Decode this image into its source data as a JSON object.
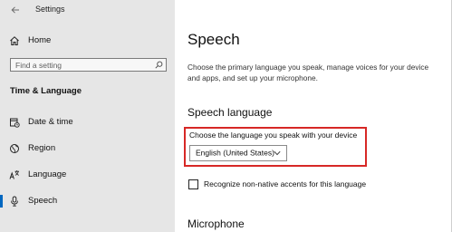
{
  "window": {
    "title": "Settings"
  },
  "sidebar": {
    "home_label": "Home",
    "search_placeholder": "Find a setting",
    "section_heading": "Time & Language",
    "items": [
      {
        "label": "Date & time",
        "icon": "clock-calendar-icon"
      },
      {
        "label": "Region",
        "icon": "globe-icon"
      },
      {
        "label": "Language",
        "icon": "language-icon"
      },
      {
        "label": "Speech",
        "icon": "microphone-icon",
        "active": true
      }
    ]
  },
  "main": {
    "title": "Speech",
    "description": "Choose the primary language you speak, manage voices for your device and apps, and set up your microphone.",
    "speech_language": {
      "heading": "Speech language",
      "field_label": "Choose the language you speak with your device",
      "selected": "English (United States)"
    },
    "recognize_checkbox": {
      "label": "Recognize non-native accents for this language",
      "checked": false
    },
    "microphone_heading": "Microphone"
  },
  "colors": {
    "sidebar_bg": "#e6e6e6",
    "accent": "#0067c0",
    "highlight": "#d72826"
  }
}
